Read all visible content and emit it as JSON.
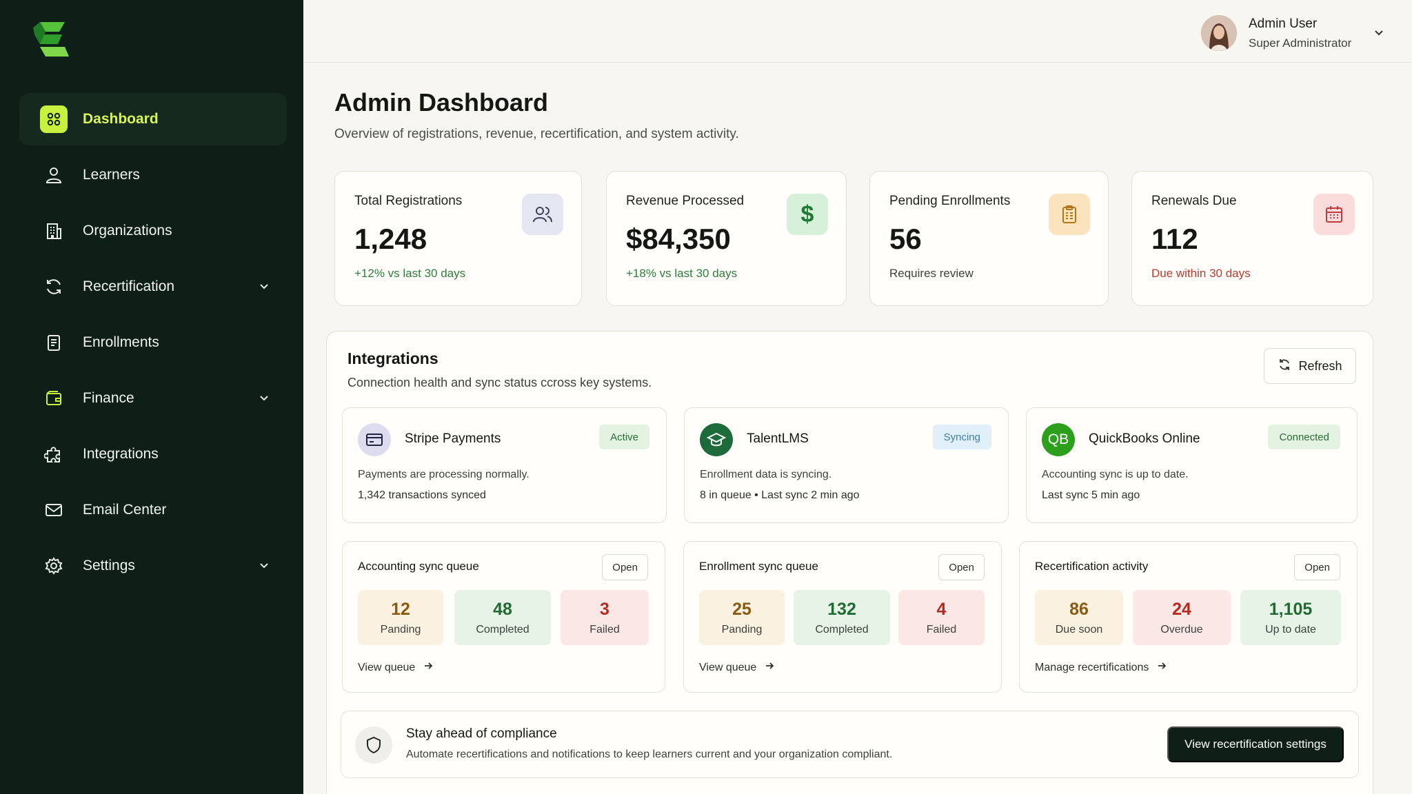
{
  "sidebar": {
    "logo_icon": "brand-logo-icon",
    "items": [
      {
        "label": "Dashboard",
        "icon": "grid-icon",
        "active": true
      },
      {
        "label": "Learners",
        "icon": "user-icon"
      },
      {
        "label": "Organizations",
        "icon": "building-icon"
      },
      {
        "label": "Recertification",
        "icon": "refresh-icon",
        "expandable": true
      },
      {
        "label": "Enrollments",
        "icon": "clipboard-icon"
      },
      {
        "label": "Finance",
        "icon": "wallet-icon",
        "expandable": true
      },
      {
        "label": "Integrations",
        "icon": "puzzle-icon"
      },
      {
        "label": "Email Center",
        "icon": "mail-icon"
      },
      {
        "label": "Settings",
        "icon": "gear-icon",
        "expandable": true
      }
    ]
  },
  "user": {
    "name": "Admin User",
    "role": "Super Administrator"
  },
  "header": {
    "title": "Admin Dashboard",
    "subtitle": "Overview of registrations, revenue, recertification, and system activity."
  },
  "stats": [
    {
      "label": "Total Registrations",
      "value": "1,248",
      "note": "+12% vs last 30 days",
      "icon": "users-icon"
    },
    {
      "label": "Revenue Processed",
      "value": "$84,350",
      "note": "+18% vs last 30 days",
      "icon": "dollar-icon"
    },
    {
      "label": "Pending Enrollments",
      "value": "56",
      "note": "Requires review",
      "icon": "clipboard-icon"
    },
    {
      "label": "Renewals Due",
      "value": "112",
      "note": "Due within 30 days",
      "icon": "calendar-icon"
    }
  ],
  "integrations": {
    "title": "Integrations",
    "subtitle": "Connection health and sync status ccross key systems.",
    "refresh_label": "Refresh",
    "cards": [
      {
        "name": "Stripe Payments",
        "badge": "Active",
        "line1": "Payments are processing normally.",
        "line2": "1,342 transactions synced"
      },
      {
        "name": "TalentLMS",
        "badge": "Syncing",
        "line1": "Enrollment data is syncing.",
        "line2": "8 in queue  •  Last sync 2 min ago"
      },
      {
        "name": "QuickBooks Online",
        "logo_text": "QB",
        "badge": "Connected",
        "line1": "Accounting sync is up to date.",
        "line2": "Last sync 5 min ago"
      }
    ],
    "queues": [
      {
        "title": "Accounting sync queue",
        "open": "Open",
        "stats": [
          {
            "value": "12",
            "label": "Panding"
          },
          {
            "value": "48",
            "label": "Completed"
          },
          {
            "value": "3",
            "label": "Failed"
          }
        ],
        "link": "View queue"
      },
      {
        "title": "Enrollment sync queue",
        "open": "Open",
        "stats": [
          {
            "value": "25",
            "label": "Panding"
          },
          {
            "value": "132",
            "label": "Completed"
          },
          {
            "value": "4",
            "label": "Failed"
          }
        ],
        "link": "View queue"
      },
      {
        "title": "Recertification activity",
        "open": "Open",
        "stats": [
          {
            "value": "86",
            "label": "Due soon"
          },
          {
            "value": "24",
            "label": "Overdue"
          },
          {
            "value": "1,105",
            "label": "Up to date"
          }
        ],
        "link": "Manage recertifications"
      }
    ],
    "compliance": {
      "title": "Stay ahead of compliance",
      "text": "Automate recertifications and notifications to keep learners current and your organization compliant.",
      "button": "View recertification settings"
    }
  },
  "colors": {
    "sidebar_bg": "#0e1f17",
    "accent": "#c8f03c",
    "positive": "#2e7d3a",
    "negative": "#c0392b"
  }
}
